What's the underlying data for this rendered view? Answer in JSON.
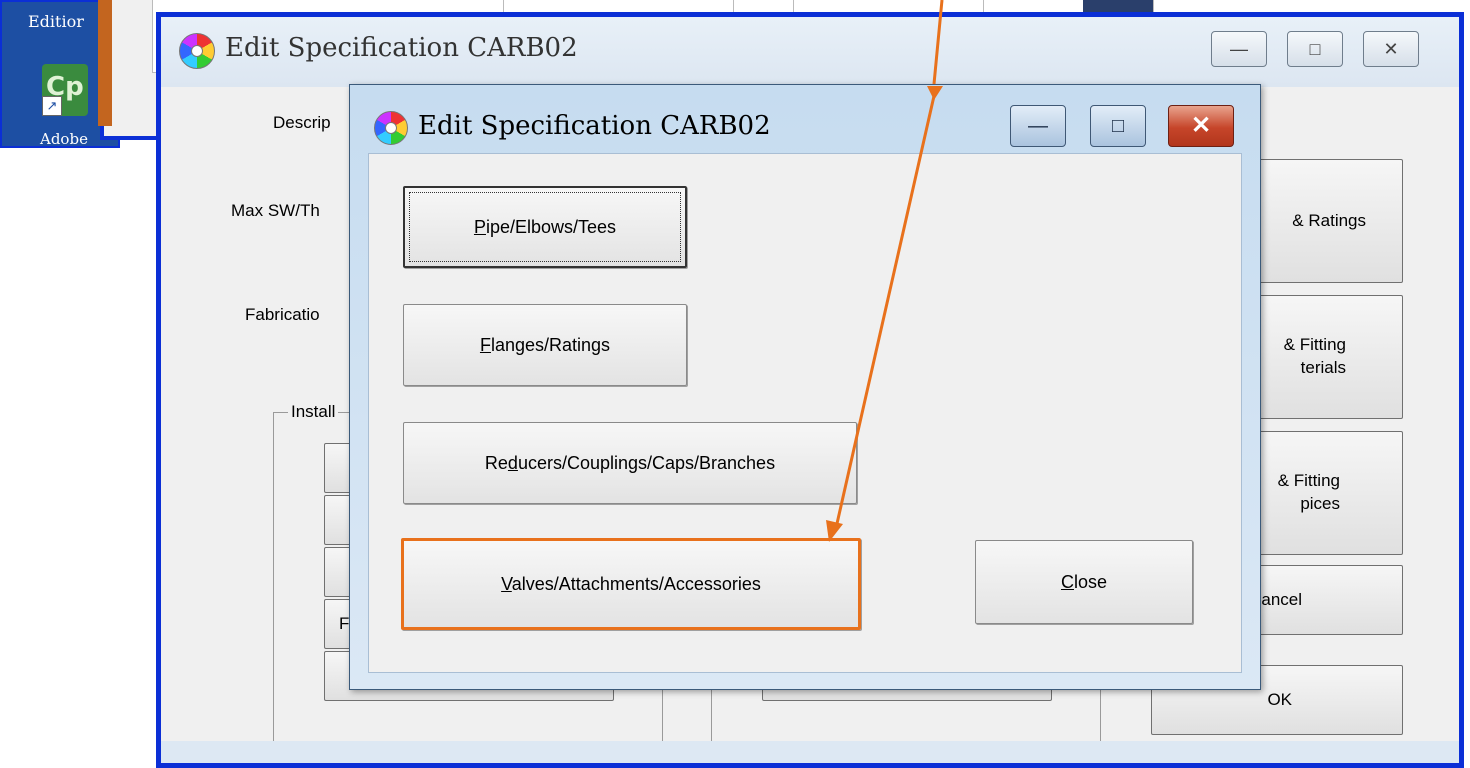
{
  "desktop": {
    "edition_text": "Editior",
    "icon_glyph": "Cp",
    "icon_label": "Adobe"
  },
  "outer_window": {
    "title": "Edit Specification  CARB02",
    "titlebar_buttons": {
      "minimize": "—",
      "maximize": "□",
      "close": "✕"
    },
    "labels": {
      "description": "Descrip",
      "max_sw": "Max SW/Th",
      "fabrication": "Fabricatio"
    },
    "group_label": "Install",
    "partial_button_letter": "F",
    "right_buttons": {
      "ratings": "& Ratings",
      "fitting_materials_line1": "& Fitting",
      "fitting_materials_line2": "terials",
      "fitting_choices_line1": "& Fitting",
      "fitting_choices_line2": "pices",
      "cancel": "ancel",
      "ok": "OK"
    }
  },
  "inner_window": {
    "title": "Edit Specification CARB02",
    "titlebar_buttons": {
      "minimize": "—",
      "maximize": "□",
      "close": "✕"
    },
    "buttons": {
      "pipe": {
        "mnemonic": "P",
        "rest": "ipe/Elbows/Tees"
      },
      "flanges": {
        "mnemonic": "F",
        "rest": "langes/Ratings"
      },
      "reducers": {
        "before": "Re",
        "mnemonic": "d",
        "rest": "ucers/Couplings/Caps/Branches"
      },
      "valves": {
        "mnemonic": "V",
        "rest": "alves/Attachments/Accessories"
      },
      "close": {
        "mnemonic": "C",
        "rest": "lose"
      }
    }
  },
  "annotation": {
    "color": "#e8711c"
  }
}
